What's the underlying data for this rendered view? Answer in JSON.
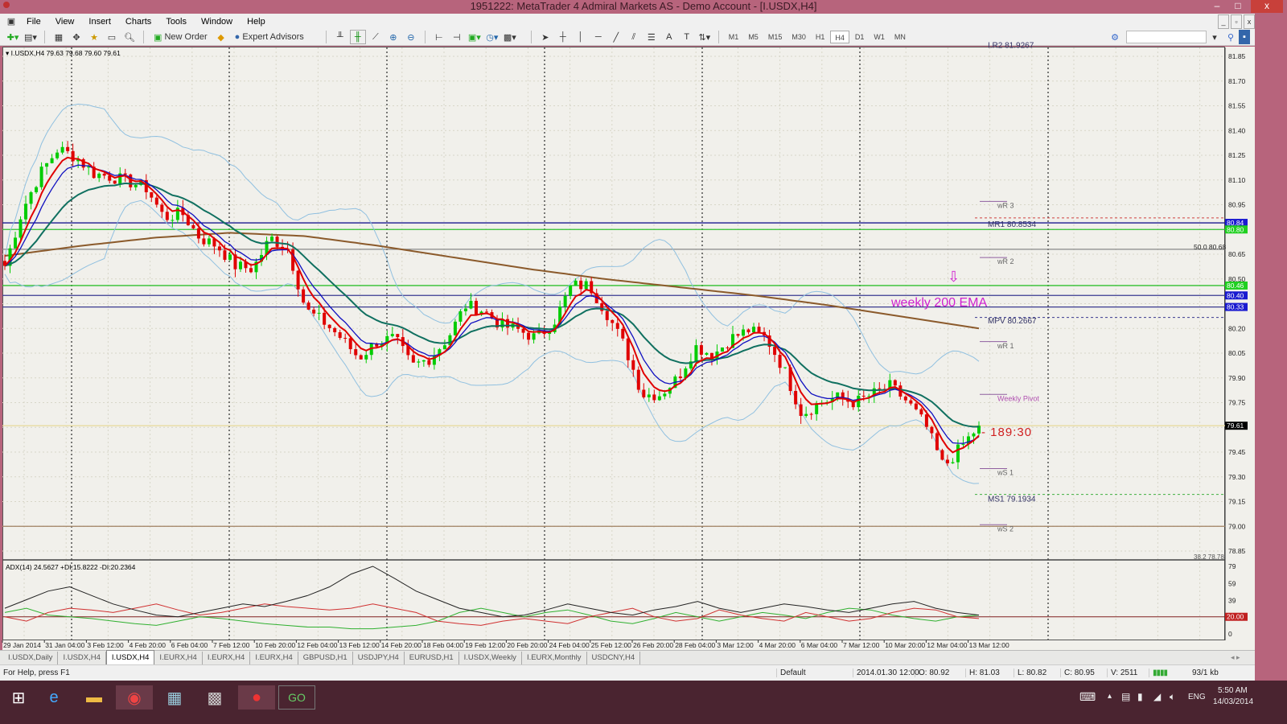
{
  "window": {
    "title": "1951222: MetaTrader 4 Admiral Markets AS - Demo Account - [I.USDX,H4]",
    "minimize": "–",
    "maximize": "□",
    "close": "x",
    "child_min": "_",
    "child_restore": "▫",
    "child_close": "x"
  },
  "menu": [
    "File",
    "View",
    "Insert",
    "Charts",
    "Tools",
    "Window",
    "Help"
  ],
  "toolbar": {
    "new_order": "New Order",
    "expert_advisors": "Expert Advisors",
    "timeframes": [
      "M1",
      "M5",
      "M15",
      "M30",
      "H1",
      "H4",
      "D1",
      "W1",
      "MN"
    ],
    "active_timeframe": "H4"
  },
  "chart": {
    "header": "I.USDX,H4  79.63 79.68 79.60 79.61",
    "price_ticks": [
      "81.85",
      "81.70",
      "81.55",
      "81.40",
      "81.25",
      "81.10",
      "80.95",
      "80.65",
      "80.50",
      "80.20",
      "80.05",
      "79.90",
      "79.75",
      "79.45",
      "79.30",
      "79.15",
      "79.00",
      "78.85"
    ],
    "current_price": "79.61",
    "badges": [
      {
        "text": "80.84",
        "color": "#1a1ad0",
        "price": 80.84
      },
      {
        "text": "80.80",
        "color": "#20d020",
        "price": 80.8
      },
      {
        "text": "80.46",
        "color": "#20d020",
        "price": 80.46
      },
      {
        "text": "80.40",
        "color": "#1a1ad0",
        "price": 80.4
      },
      {
        "text": "80.33",
        "color": "#1a1ad0",
        "price": 80.33
      }
    ],
    "levels": [
      {
        "price": 80.84,
        "color": "#1a1a90",
        "style": "solid"
      },
      {
        "price": 80.8,
        "color": "#30c030",
        "style": "solid"
      },
      {
        "price": 80.68,
        "color": "#888888",
        "style": "solid"
      },
      {
        "price": 80.46,
        "color": "#30c030",
        "style": "solid"
      },
      {
        "price": 80.4,
        "color": "#3a3a90",
        "style": "solid"
      },
      {
        "price": 80.33,
        "color": "#3a3a90",
        "style": "solid"
      },
      {
        "price": 79.0,
        "color": "#a08060",
        "style": "solid"
      },
      {
        "price": 79.61,
        "color": "#e8dca0",
        "style": "solid"
      },
      {
        "price": 80.87,
        "color": "#d04040",
        "style": "dashed",
        "from_right": true
      },
      {
        "price": 80.2667,
        "color": "#3a3a90",
        "style": "dashed",
        "from_right": true
      },
      {
        "price": 79.1934,
        "color": "#40b040",
        "style": "dashed",
        "from_right": true
      }
    ],
    "labels": [
      {
        "text": "I.R2  81.9267",
        "price": 81.92,
        "color": "#333366"
      },
      {
        "text": "wR 3",
        "price": 80.95,
        "color": "#666"
      },
      {
        "text": "MR1   80.8534",
        "price": 80.835,
        "color": "#333366"
      },
      {
        "text": "wR 2",
        "price": 80.61,
        "color": "#666"
      },
      {
        "text": "MPV   80.2667",
        "price": 80.25,
        "color": "#333366"
      },
      {
        "text": "wR 1",
        "price": 80.1,
        "color": "#666"
      },
      {
        "text": "Weekly Pivot",
        "price": 79.78,
        "color": "#b050b0"
      },
      {
        "text": "wS 1",
        "price": 79.33,
        "color": "#666"
      },
      {
        "text": "MS1   79.1934",
        "price": 79.17,
        "color": "#333366"
      },
      {
        "text": "wS 2",
        "price": 78.99,
        "color": "#666"
      }
    ],
    "fib_label": "50.0  80.68",
    "fib_label2": "38.2  78.78",
    "ema_label": "weekly 200 EMA",
    "timer": "189:30",
    "arrow": "⇩",
    "colors": {
      "bull": "#00cc00",
      "bear": "#e00000",
      "fast_ma": "#e00000",
      "mid_ma": "#1010c0",
      "slow_ma": "#107060",
      "ema200": "#8b5a2b",
      "bands": "#90c0e0",
      "accent": "#d020d0"
    },
    "time_labels": [
      "29 Jan 2014",
      "31 Jan 04:00",
      "3 Feb 12:00",
      "4 Feb 20:00",
      "6 Feb 04:00",
      "7 Feb 12:00",
      "10 Feb 20:00",
      "12 Feb 04:00",
      "13 Feb 12:00",
      "14 Feb 20:00",
      "18 Feb 04:00",
      "19 Feb 12:00",
      "20 Feb 20:00",
      "24 Feb 04:00",
      "25 Feb 12:00",
      "26 Feb 20:00",
      "28 Feb 04:00",
      "3 Mar 12:00",
      "4 Mar 20:00",
      "6 Mar 04:00",
      "7 Mar 12:00",
      "10 Mar 20:00",
      "12 Mar 04:00",
      "13 Mar 12:00"
    ]
  },
  "chart_data": {
    "type": "candlestick",
    "symbol": "I.USDX,H4",
    "ylim": [
      78.85,
      81.9
    ],
    "close_path": [
      80.58,
      80.92,
      81.14,
      81.29,
      81.24,
      81.14,
      81.12,
      81.09,
      81.05,
      80.87,
      80.9,
      80.75,
      80.7,
      80.58,
      80.56,
      80.75,
      80.68,
      80.31,
      80.24,
      80.14,
      80.02,
      80.12,
      80.14,
      79.97,
      80.02,
      80.14,
      80.34,
      80.31,
      80.22,
      80.19,
      80.14,
      80.24,
      80.46,
      80.46,
      80.29,
      80.09,
      79.8,
      79.8,
      79.9,
      80.09,
      80.04,
      80.14,
      80.19,
      80.14,
      79.95,
      79.68,
      79.75,
      79.78,
      79.75,
      79.8,
      79.85,
      79.75,
      79.61,
      79.36,
      79.48,
      79.61
    ],
    "ema200_path": [
      80.64,
      80.7,
      80.75,
      80.78,
      80.76,
      80.7,
      80.63,
      80.56,
      80.5,
      80.45,
      80.4,
      80.34,
      80.27,
      80.2
    ],
    "indicator": {
      "header": "ADX(14) 24.5627 +DI:15.8222 -DI:20.2364",
      "ticks": [
        "79",
        "59",
        "39",
        "19",
        "0"
      ],
      "level": "20.00",
      "ylim": [
        0,
        79
      ],
      "adx": [
        30,
        40,
        50,
        55,
        45,
        35,
        28,
        22,
        20,
        25,
        30,
        35,
        32,
        38,
        45,
        55,
        70,
        79,
        65,
        50,
        40,
        30,
        25,
        20,
        22,
        28,
        35,
        30,
        25,
        22,
        28,
        32,
        38,
        30,
        25,
        30,
        35,
        32,
        28,
        25,
        30,
        35,
        38,
        30,
        25,
        22
      ],
      "plus_di": [
        25,
        30,
        22,
        20,
        18,
        15,
        12,
        10,
        15,
        20,
        18,
        15,
        12,
        10,
        8,
        8,
        6,
        6,
        8,
        10,
        15,
        25,
        30,
        25,
        20,
        25,
        28,
        22,
        15,
        12,
        18,
        25,
        20,
        15,
        20,
        25,
        22,
        18,
        25,
        30,
        28,
        22,
        18,
        15,
        20,
        22
      ],
      "minus_di": [
        20,
        15,
        25,
        30,
        28,
        25,
        30,
        35,
        28,
        22,
        25,
        30,
        35,
        32,
        30,
        28,
        30,
        35,
        30,
        25,
        15,
        12,
        10,
        15,
        18,
        15,
        12,
        20,
        25,
        30,
        20,
        15,
        18,
        28,
        22,
        18,
        15,
        25,
        20,
        15,
        18,
        25,
        30,
        28,
        20,
        18
      ]
    }
  },
  "tabs": [
    "I.USDX,Daily",
    "I.USDX,H4",
    "I.USDX,H4",
    "I.EURX,H4",
    "I.EURX,H4",
    "I.EURX,H4",
    "GBPUSD,H1",
    "USDJPY,H4",
    "EURUSD,H1",
    "I.USDX,Weekly",
    "I.EURX,Monthly",
    "USDCNY,H4"
  ],
  "active_tab": 2,
  "status": {
    "help": "For Help, press F1",
    "profile": "Default",
    "time": "2014.01.30 12:00",
    "open": "O: 80.92",
    "high": "H: 81.03",
    "low": "L: 80.82",
    "close": "C: 80.95",
    "volume": "V: 2511",
    "traffic": "93/1 kb"
  },
  "taskbar": {
    "lang": "ENG",
    "time": "5:50 AM",
    "date": "14/03/2014"
  }
}
